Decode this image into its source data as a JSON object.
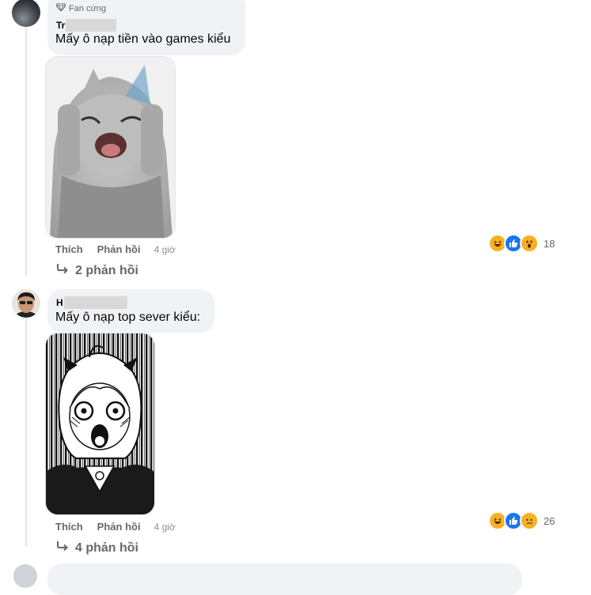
{
  "comments": [
    {
      "badge": "Fan cứng",
      "name_prefix": "Tr",
      "text": "Mấy ô nạp tiền vào games kiểu",
      "like_label": "Thích",
      "reply_label": "Phản hồi",
      "time": "4 giờ",
      "reaction_count": "18",
      "reactions": [
        "haha-icon",
        "like-icon",
        "wow-icon"
      ],
      "replies_label": "2 phản hồi"
    },
    {
      "name_prefix": "H",
      "text": "Mấy ô nạp top sever kiểu:",
      "like_label": "Thích",
      "reply_label": "Phản hồi",
      "time": "4 giờ",
      "reaction_count": "26",
      "reactions": [
        "haha-icon",
        "like-icon",
        "sad-icon"
      ],
      "replies_label": "4 phản hồi"
    }
  ],
  "colors": {
    "bubble": "#f0f2f5",
    "muted": "#65676b",
    "like_blue": "#1877f2",
    "emoji_yellow": "#f7b125"
  }
}
